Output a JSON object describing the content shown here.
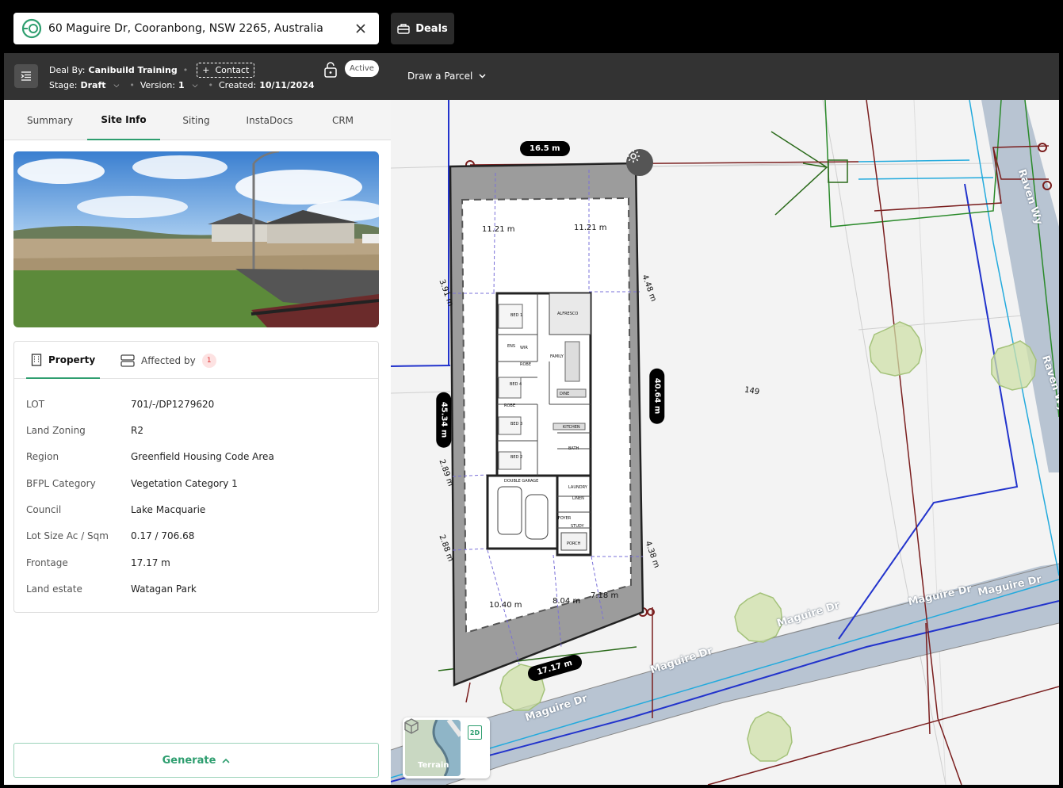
{
  "search": {
    "address": "60 Maguire Dr, Cooranbong, NSW 2265, Australia",
    "logo_icon": "canibuild-logo-icon",
    "clear_icon": "close-icon"
  },
  "deals_button": {
    "label": "Deals",
    "icon": "briefcase-icon"
  },
  "deal": {
    "by_label": "Deal By:",
    "by_value": "Canibuild Training",
    "contact_label": "Contact",
    "stage_label": "Stage:",
    "stage_value": "Draft",
    "version_label": "Version:",
    "version_value": "1",
    "created_label": "Created:",
    "created_value": "10/11/2024",
    "status": "Active"
  },
  "tabs": [
    "Summary",
    "Site Info",
    "Siting",
    "InstaDocs",
    "CRM"
  ],
  "active_tab": "Site Info",
  "property_tabs": {
    "property": "Property",
    "affected_by": "Affected by",
    "affected_count": "1"
  },
  "property": [
    {
      "label": "LOT",
      "value": "701/-/DP1279620"
    },
    {
      "label": "Land Zoning",
      "value": "R2"
    },
    {
      "label": "Region",
      "value": "Greenfield Housing Code Area"
    },
    {
      "label": "BFPL Category",
      "value": "Vegetation Category 1"
    },
    {
      "label": "Council",
      "value": "Lake Macquarie"
    },
    {
      "label": "Lot Size Ac / Sqm",
      "value": "0.17 / 706.68"
    },
    {
      "label": "Frontage",
      "value": "17.17 m"
    },
    {
      "label": "Land estate",
      "value": "Watagan Park"
    }
  ],
  "generate_button": "Generate",
  "map": {
    "draw_parcel": "Draw a Parcel",
    "dims": {
      "top": "16.5 m",
      "left": "45.34 m",
      "right": "40.64 m",
      "bottom": "17.17 m"
    },
    "setbacks": {
      "top_left": "11.21 m",
      "top_right": "11.21 m",
      "left_upper": "3.91 m",
      "right_upper": "4.48 m",
      "left_mid": "2.89 m",
      "left_lower": "2.88 m",
      "right_lower": "4.38 m",
      "bottom_left": "10.40 m",
      "bottom_mid": "8.04 m",
      "bottom_right": "7.18 m"
    },
    "lot_number": "149",
    "roads": {
      "raven_1": "Raven Wy",
      "raven_2": "Raven Wy",
      "maguire_1": "Maguire Dr",
      "maguire_2": "Maguire Dr",
      "maguire_3": "Maguire Dr",
      "maguire_4": "Maguire Dr",
      "maguire_5": "Maguire Dr"
    },
    "rooms": {
      "bed1": "BED 1",
      "alfresco": "ALFRESCO",
      "ens": "ENS",
      "wir": "WIR",
      "robe1": "ROBE",
      "family": "FAMILY",
      "bed4": "BED 4",
      "dine": "DINE",
      "robe2": "ROBE",
      "bed3": "BED 3",
      "kitchen": "KITCHEN",
      "bath": "BATH",
      "bed2": "BED 2",
      "garage": "DOUBLE GARAGE",
      "laundry": "LAUNDRY",
      "linen": "LINEN",
      "foyer": "FOYER",
      "study": "STUDY",
      "porch": "PORCH"
    },
    "terrain_label": "Terrain",
    "mode_2d": "2D",
    "mode_3d_icon": "cube-icon",
    "settings_icon": "gear-icon"
  }
}
